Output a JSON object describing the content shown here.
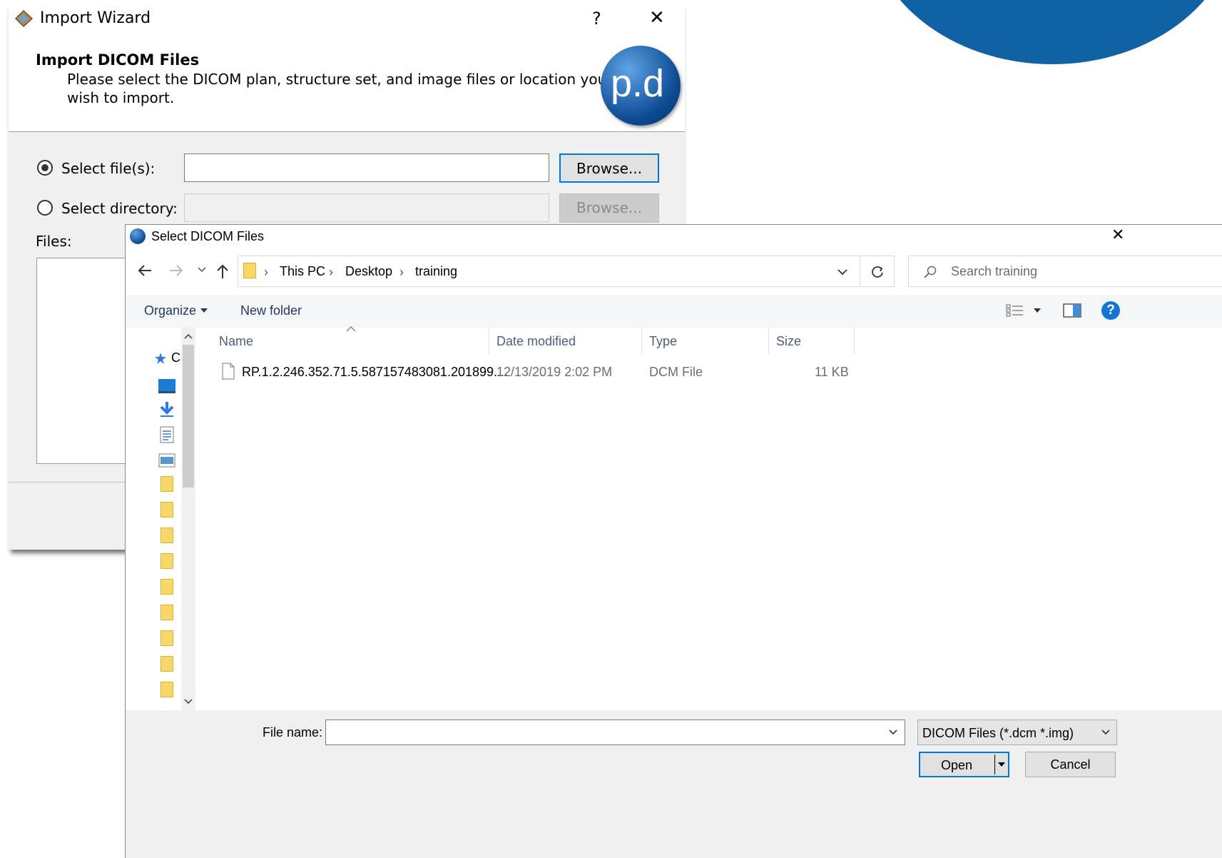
{
  "wizard": {
    "title": "Import Wizard",
    "help_label": "?",
    "close_label": "✕",
    "heading": "Import DICOM Files",
    "description_line1": "Please select the DICOM plan, structure set, and image files or location you",
    "description_line2": "wish to import.",
    "logo_text": "p.d",
    "select_files_label": "Select file(s):",
    "select_files_value": "",
    "select_directory_label": "Select directory:",
    "select_directory_value": "",
    "browse_files_label": "Browse...",
    "browse_directory_label": "Browse...",
    "files_label": "Files:"
  },
  "dialog": {
    "title": "Select DICOM Files",
    "close_label": "✕",
    "breadcrumb": [
      "This PC",
      "Desktop",
      "training"
    ],
    "search_placeholder": "Search training",
    "toolbar": {
      "organize_label": "Organize",
      "new_folder_label": "New folder"
    },
    "columns": {
      "name": "Name",
      "date": "Date modified",
      "type": "Type",
      "size": "Size"
    },
    "files": [
      {
        "name": "RP.1.2.246.352.71.5.587157483081.201899....",
        "date": "12/13/2019 2:02 PM",
        "type": "DCM File",
        "size": "11 KB"
      }
    ],
    "nav_quick_access_label": "C",
    "file_name_label": "File name:",
    "file_name_value": "",
    "file_type_value": "DICOM Files (*.dcm *.img)",
    "open_label": "Open",
    "cancel_label": "Cancel"
  },
  "colors": {
    "accent_blue": "#1161a5",
    "folder_yellow": "#f6d767",
    "selection_border": "#0078d7"
  },
  "icons": [
    "import-wizard-app-icon",
    "help-icon",
    "close-icon",
    "pd-logo-icon",
    "pd-small-app-icon",
    "back-arrow-icon",
    "forward-arrow-icon",
    "recent-locations-chevron-icon",
    "up-arrow-icon",
    "folder-icon",
    "chevron-right-icon",
    "dropdown-chevron-icon",
    "refresh-icon",
    "search-icon",
    "view-options-icon",
    "preview-pane-icon",
    "help-circle-icon",
    "sort-up-icon",
    "file-icon",
    "quick-access-star-icon",
    "desktop-icon",
    "downloads-icon",
    "documents-icon",
    "pictures-icon"
  ]
}
